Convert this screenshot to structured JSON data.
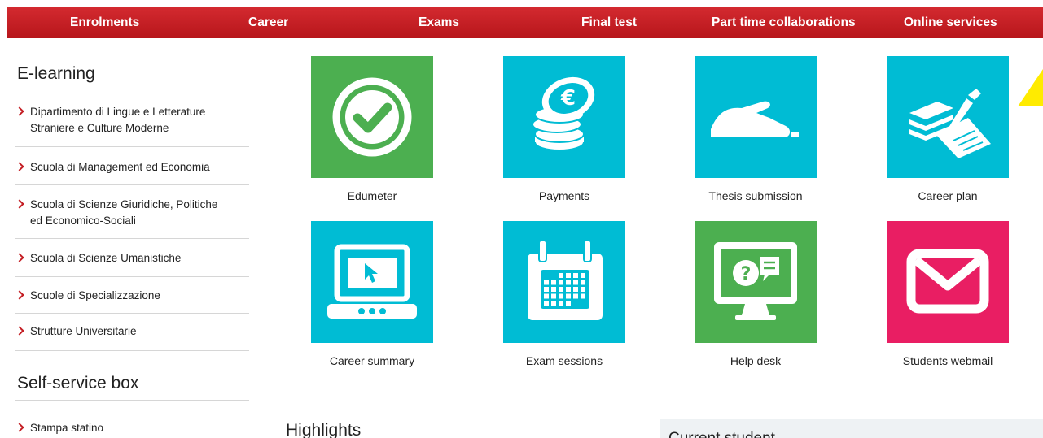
{
  "nav": {
    "items": [
      "Enrolments",
      "Career",
      "Exams",
      "Final test",
      "Part time collaborations",
      "Online services"
    ]
  },
  "sidebar": {
    "elearning_title": "E-learning",
    "elearning_items": [
      "Dipartimento di Lingue e Letterature",
      "Straniere e Culture Moderne",
      "Scuola di Management ed Economia",
      "Scuola di Scienze Giuridiche, Politiche",
      "ed Economico-Sociali",
      "Scuola di Scienze Umanistiche",
      "Scuole di Specializzazione",
      "Strutture Universitarie"
    ],
    "selfservice_title": "Self-service box",
    "selfservice_items": [
      "Stampa statino"
    ]
  },
  "tiles": [
    {
      "label": "Edumeter",
      "icon": "checkmark-circle-icon",
      "color": "#4caf50"
    },
    {
      "label": "Payments",
      "icon": "euro-coins-icon",
      "color": "#00bcd4"
    },
    {
      "label": "Thesis submission",
      "icon": "hand-mouse-icon",
      "color": "#00bcd4"
    },
    {
      "label": "Career plan",
      "icon": "books-pen-icon",
      "color": "#00bcd4"
    },
    {
      "label": "Career summary",
      "icon": "laptop-cursor-icon",
      "color": "#00bcd4"
    },
    {
      "label": "Exam sessions",
      "icon": "calendar-icon",
      "color": "#00bcd4"
    },
    {
      "label": "Help desk",
      "icon": "monitor-chat-icon",
      "color": "#4caf50"
    },
    {
      "label": "Students webmail",
      "icon": "envelope-icon",
      "color": "#e91e63"
    }
  ],
  "main": {
    "highlights_title": "Highlights",
    "current_student_title": "Current student"
  },
  "colors": {
    "nav_red": "#c41e24",
    "tile_green": "#4caf50",
    "tile_cyan": "#00bcd4",
    "tile_pink": "#e91e63"
  }
}
